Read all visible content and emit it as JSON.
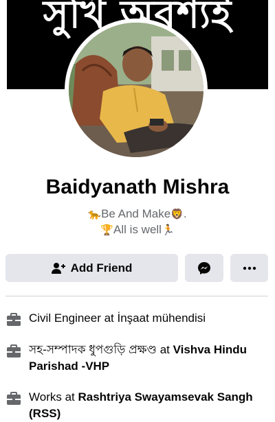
{
  "cover": {
    "text": "সুখি অবশ্যই"
  },
  "profile": {
    "name": "Baidyanath Mishra",
    "bio_line1_icon_left": "lion-icon",
    "bio_line1": "Be And Make",
    "bio_line1_icon_right": "lion-face-icon",
    "bio_line1_suffix": ".",
    "bio_line2_icon_left": "trophy-icon",
    "bio_line2": "All is well",
    "bio_line2_icon_right": "runner-icon"
  },
  "actions": {
    "add_friend_label": "Add Friend",
    "add_friend_icon": "add-friend-icon",
    "messenger_icon": "messenger-icon",
    "more_icon": "more-icon"
  },
  "intro": {
    "items": [
      {
        "icon": "briefcase-icon",
        "prefix": "Civil Engineer at İnşaat mühendisi",
        "bold": ""
      },
      {
        "icon": "briefcase-icon",
        "prefix": "সহ-সম্পাদক ধুপগুড়ি প্রক্ষণ্ড at ",
        "bold": "Vishva Hindu Parishad -VHP"
      },
      {
        "icon": "briefcase-icon",
        "prefix": "Works at ",
        "bold": "Rashtriya Swayamsevak Sangh (RSS)"
      }
    ]
  },
  "colors": {
    "button_bg": "#e4e6eb",
    "secondary_text": "#65676b",
    "icon_gray": "#65676b"
  }
}
